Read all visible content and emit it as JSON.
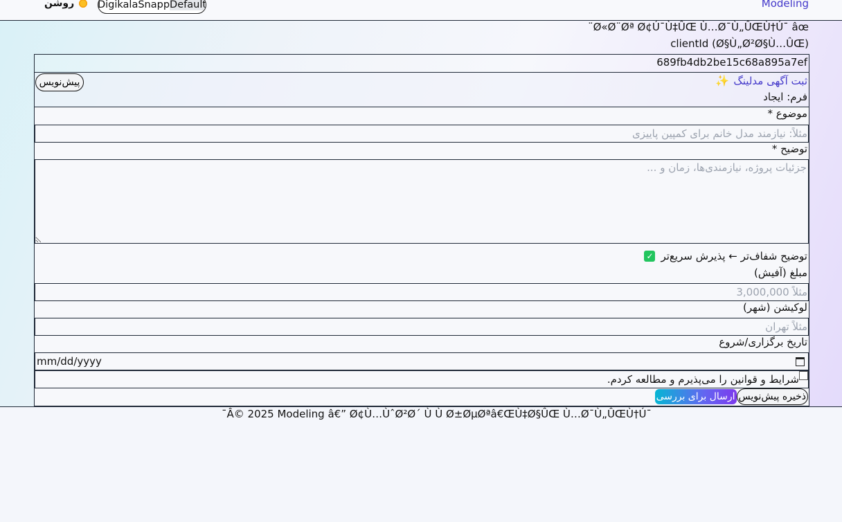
{
  "header": {
    "brand": "Modeling",
    "theme_options": [
      "Digikala",
      "Snapp",
      "Default"
    ],
    "theme_active": "Default",
    "light_label": "روشن"
  },
  "main": {
    "garbled_title": "¨Ø«Ø¨Øª Ø¢Ú¯Ù‡ÛŒ Ù…Ø¯Ù„ÛŒÙ†Ú¯ âœ",
    "client_id_label": "clientId (Ø§Ù„Ø²Ø§Ù…ÛŒ)",
    "client_id_value": "689fb4db2be15c68a895a7ef",
    "section_title": "ثبت آگهی مدلینگ",
    "draft_button": "پیش‌نویس",
    "form_mode": "فرم: ایجاد",
    "fields": {
      "subject_label": "موضوع *",
      "subject_placeholder": "مثلاً: نیازمند مدل خانم برای کمپین پاییزی",
      "description_label": "توضیح *",
      "description_placeholder": "جزئیات پروژه، نیازمندی‌ها، زمان و ...",
      "hint": "توضیح شفاف‌تر ← پذیرش سریع‌تر",
      "amount_label": "مبلغ (آفیش)",
      "amount_placeholder": "مثلاً 3,000,000",
      "location_label": "لوکیشن (شهر)",
      "location_placeholder": "مثلاً تهران",
      "date_label": "تاریخ برگزاری/شروع",
      "date_placeholder": "mm/dd/yyyy",
      "terms_label": "شرایط و قوانین را می‌پذیرم و مطالعه کردم."
    },
    "actions": {
      "save_draft": "ذخیره پیش‌نویس",
      "submit": "ارسال برای بررسی"
    }
  },
  "footer": {
    "text": "¯Â© 2025 Modeling â€” Ø¢Ù…ÙˆØ²Ø´ Ù Ù Ø±ØµØªâ€ŒÙ‡Ø§ÛŒ Ù…Ø¯Ù„ÛŒÙ†Ú¯"
  }
}
